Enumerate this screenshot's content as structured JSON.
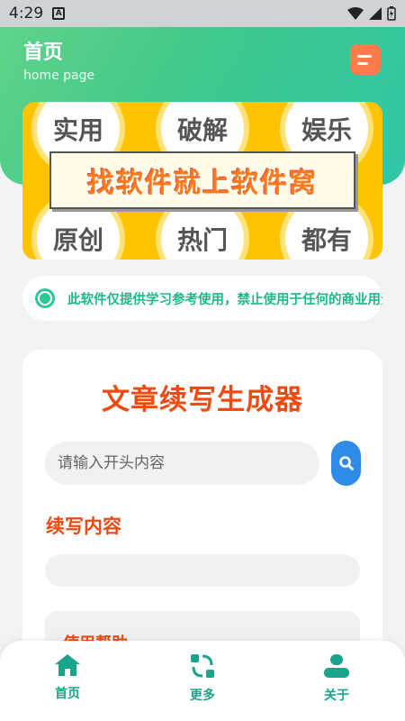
{
  "status_bar": {
    "time": "4:29",
    "notification_badge": "A"
  },
  "header": {
    "title": "首页",
    "subtitle": "home page",
    "menu_icon": "list-icon"
  },
  "banner": {
    "headline": "找软件就上软件窝",
    "tags": [
      "实用",
      "破解",
      "娱乐",
      "原创",
      "热门",
      "都有"
    ]
  },
  "notice": {
    "text": "此软件仅提供学习参考使用，禁止使用于任何的商业用途"
  },
  "card": {
    "title": "文章续写生成器",
    "input_placeholder": "请输入开头内容",
    "output_label": "续写内容",
    "output_value": "",
    "help_label": "使用帮助"
  },
  "nav": {
    "items": [
      {
        "label": "首页",
        "icon": "home-icon"
      },
      {
        "label": "更多",
        "icon": "refresh-apps-icon"
      },
      {
        "label": "关于",
        "icon": "user-icon"
      }
    ]
  },
  "colors": {
    "accent": "#ee4a12",
    "brand_green": "#2ec79a",
    "search_blue": "#2f8be8"
  }
}
